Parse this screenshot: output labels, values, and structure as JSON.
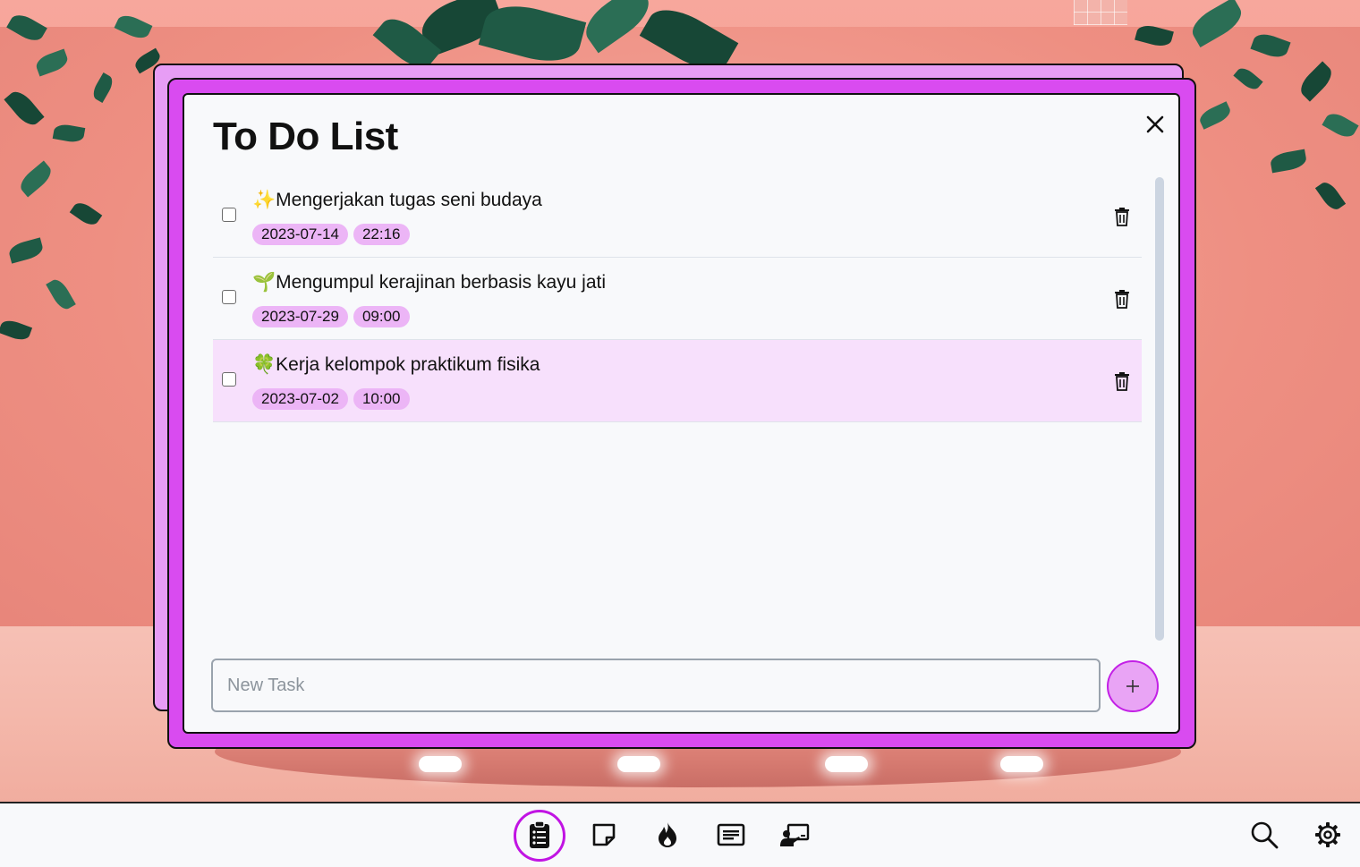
{
  "dialog": {
    "title": "To Do List",
    "close_icon": "close-icon"
  },
  "tasks": [
    {
      "title": "✨Mengerjakan tugas seni budaya",
      "date": "2023-07-14",
      "time": "22:16",
      "checked": false,
      "highlighted": false
    },
    {
      "title": "🌱Mengumpul kerajinan berbasis kayu jati",
      "date": "2023-07-29",
      "time": "09:00",
      "checked": false,
      "highlighted": false
    },
    {
      "title": "🍀Kerja kelompok praktikum fisika",
      "date": "2023-07-02",
      "time": "10:00",
      "checked": false,
      "highlighted": true
    }
  ],
  "new_task": {
    "placeholder": "New Task",
    "value": "",
    "add_icon": "plus-icon"
  },
  "taskbar": {
    "items": [
      {
        "name": "todo-list",
        "icon": "clipboard-list-icon",
        "active": true
      },
      {
        "name": "sticky-note",
        "icon": "sticky-note-icon",
        "active": false
      },
      {
        "name": "streak",
        "icon": "flame-icon",
        "active": false
      },
      {
        "name": "notes",
        "icon": "text-box-icon",
        "active": false
      },
      {
        "name": "presenter",
        "icon": "presenter-icon",
        "active": false
      }
    ],
    "right_items": [
      {
        "name": "search",
        "icon": "search-icon"
      },
      {
        "name": "settings",
        "icon": "gear-icon"
      }
    ]
  },
  "colors": {
    "accent": "#d94bf0",
    "accent_light": "#e9a4f5",
    "tag_bg": "#ecb5f6",
    "highlight_row": "#f7e0fc",
    "active_ring": "#c114e3"
  }
}
